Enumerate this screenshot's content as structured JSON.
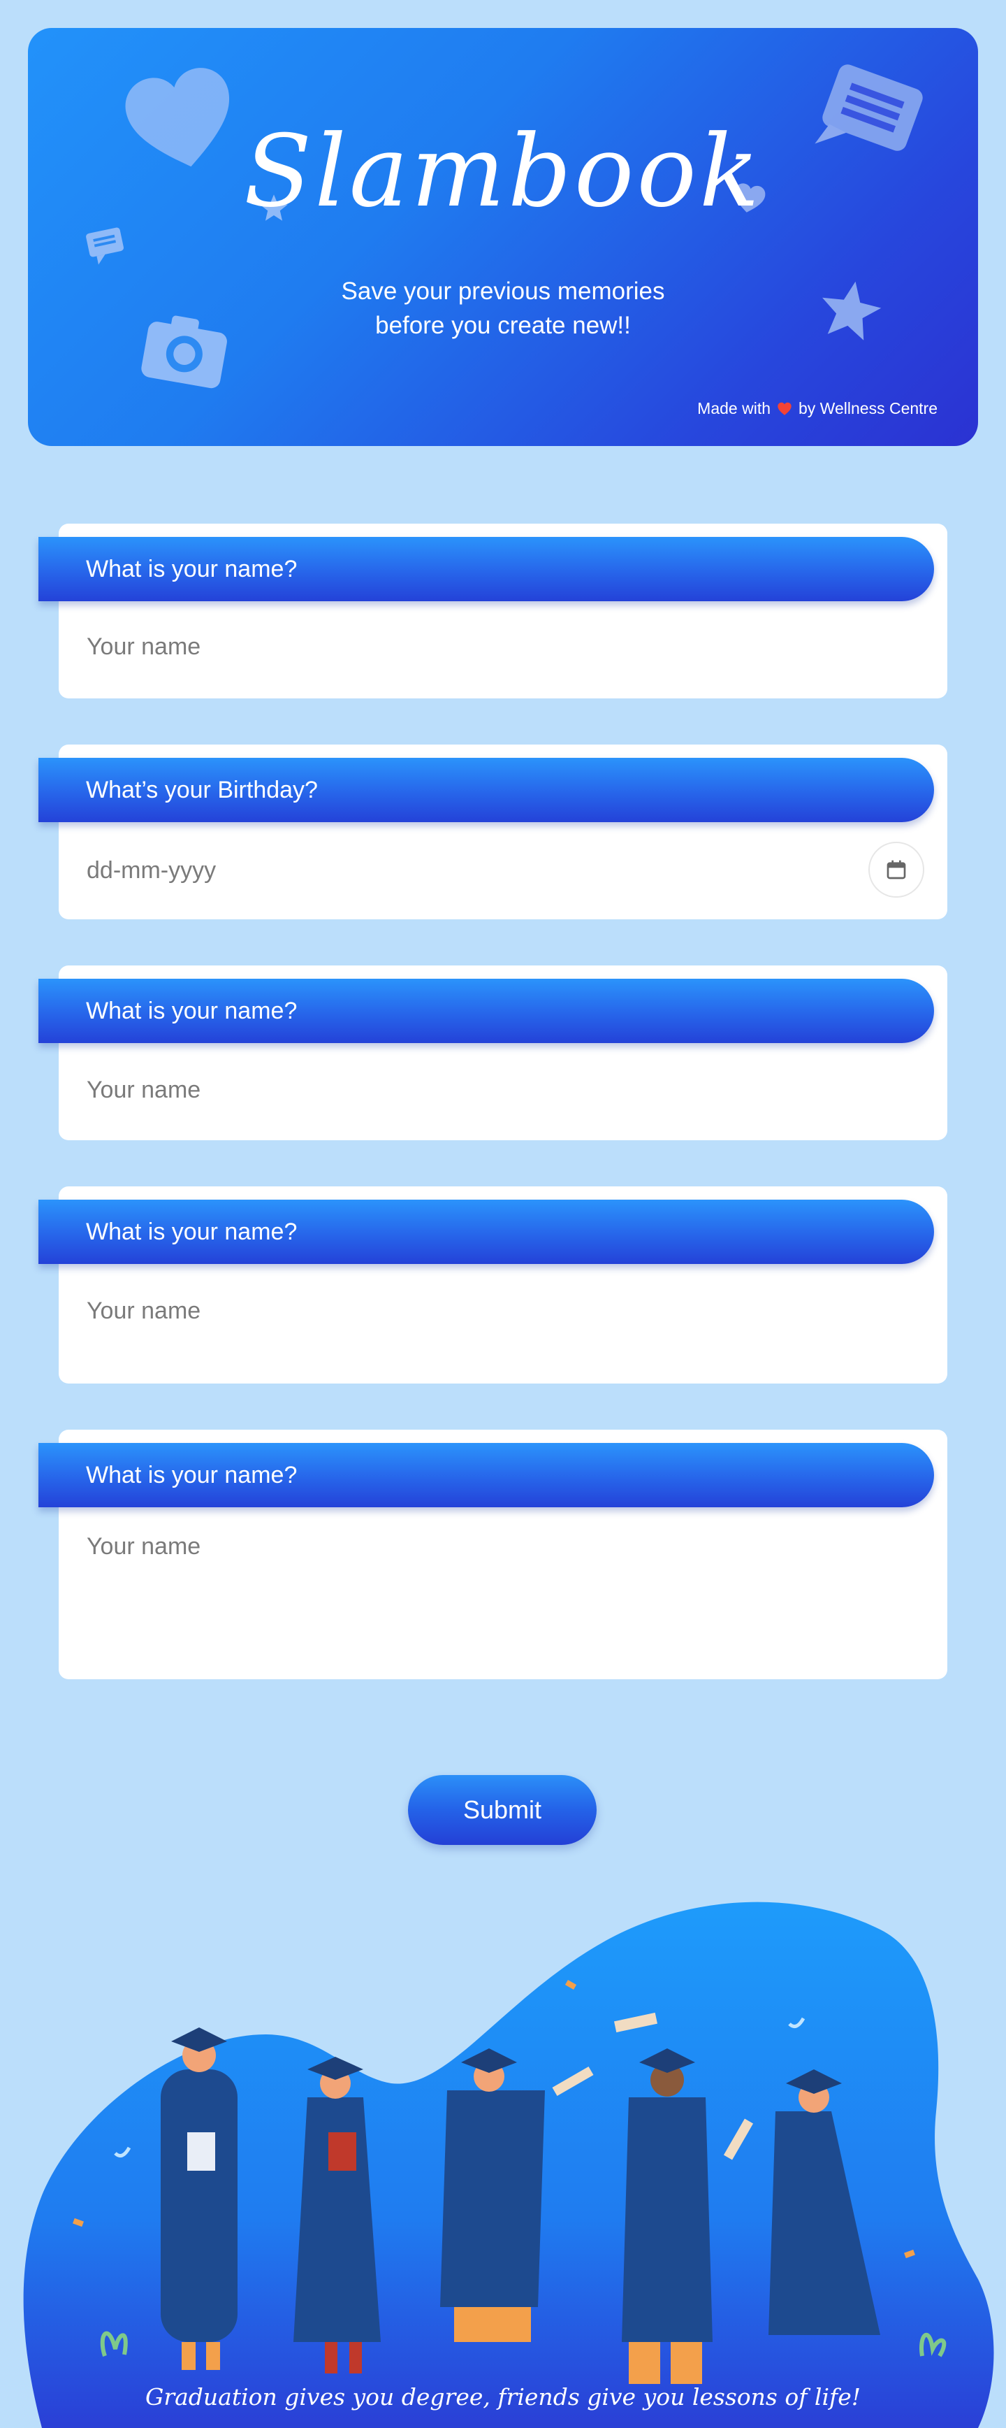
{
  "header": {
    "title": "Slambook",
    "subtitle_line1": "Save your previous memories",
    "subtitle_line2": "before you create new!!",
    "made_with_prefix": "Made with",
    "made_with_suffix": "by Wellness Centre"
  },
  "questions": [
    {
      "label": "What is your name?",
      "placeholder": "Your name"
    },
    {
      "label": "What’s your Birthday?",
      "placeholder": "dd-mm-yyyy"
    },
    {
      "label": "What is your name?",
      "placeholder": "Your name"
    },
    {
      "label": "What is your name?",
      "placeholder": "Your name"
    },
    {
      "label": "What is your name?",
      "placeholder": "Your name"
    }
  ],
  "submit_label": "Submit",
  "footer": {
    "caption": "Graduation gives you degree, friends give you lessons of life!"
  },
  "colors": {
    "page_background": "#bbdefb",
    "hero_gradient_start": "#2292fa",
    "hero_gradient_end": "#2b32d2",
    "accent_heart": "#f44336"
  },
  "icons": [
    "heart-icon",
    "chat-icon",
    "camera-icon",
    "star-icon",
    "calendar-icon"
  ]
}
